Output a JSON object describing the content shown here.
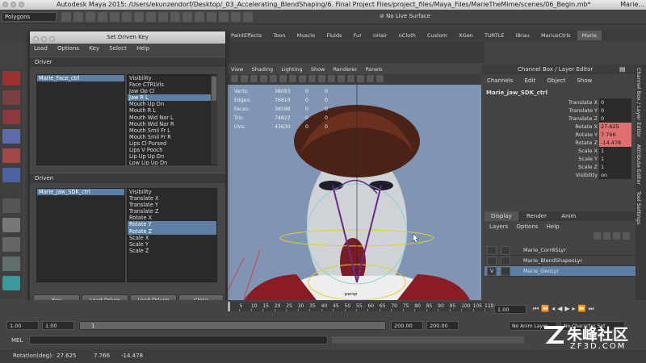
{
  "window": {
    "title": "Autodesk Maya 2015: /Users/ekunzendorf/Desktop/_03_Accelerating_BlendShaping/6. Final Project Files/project_files/Maya_Files/MarieTheMime/scenes/06_Begin.mb*",
    "right_label": "Marie..."
  },
  "statusline": {
    "mode": "Polygons",
    "live_surface": "No Live Surface"
  },
  "shelf": {
    "left_label": "PaintEffects",
    "tabs": [
      "Toon",
      "Muscle",
      "Fluids",
      "Fur",
      "nHair",
      "nCloth",
      "Custom",
      "XGen",
      "TURTLE",
      "iBrau",
      "MariusCtrls",
      "Marie"
    ]
  },
  "dialog": {
    "title": "Set Driven Key",
    "menu": [
      "Load",
      "Options",
      "Key",
      "Select",
      "Help"
    ],
    "driver_header": "Driver",
    "driver_object": "Marie_Face_ctrl",
    "driver_attrs": [
      "Visibility",
      "Face CTRLVis",
      "Jaw Op Cl",
      "Jaw R L",
      "Mouth Up Dn",
      "Mouth R L",
      "Mouth Wid Nar L",
      "Mouth Wid Nar R",
      "Mouth Smil Fr L",
      "Mouth Smil Fr R",
      "Lips Cl Pursed",
      "Lips V Pooch",
      "Lip Up Up Dn",
      "Low Lip Up Dn"
    ],
    "driver_selected_index": 3,
    "driven_header": "Driven",
    "driven_object": "Marie_jaw_SDK_ctrl",
    "driven_attrs": [
      "Visibility",
      "Translate X",
      "Translate Y",
      "Translate Z",
      "Rotate X",
      "Rotate Y",
      "Rotate Z",
      "Scale X",
      "Scale Y",
      "Scale Z"
    ],
    "driven_selected": [
      5,
      6
    ],
    "buttons": [
      "Key",
      "Load Driver",
      "Load Driven",
      "Close"
    ]
  },
  "viewport": {
    "menu": [
      "View",
      "Shading",
      "Lighting",
      "Show",
      "Renderer",
      "Panels"
    ],
    "hud": [
      {
        "label": "Verts:",
        "a": "38093",
        "b": "0",
        "c": "0"
      },
      {
        "label": "Edges:",
        "a": "76819",
        "b": "0",
        "c": "0"
      },
      {
        "label": "Faces:",
        "a": "38598",
        "b": "0",
        "c": "0"
      },
      {
        "label": "Tris:",
        "a": "74822",
        "b": "0",
        "c": "0"
      },
      {
        "label": "UVs:",
        "a": "43630",
        "b": "0",
        "c": "0"
      }
    ],
    "camera_label": "persp"
  },
  "channelbox": {
    "header": "Channel Box / Layer Editor",
    "menu": [
      "Channels",
      "Edit",
      "Object",
      "Show"
    ],
    "object": "Marie_jaw_SDK_ctrl",
    "channels": [
      {
        "name": "Translate X",
        "value": "0",
        "hl": false
      },
      {
        "name": "Translate Y",
        "value": "0",
        "hl": false
      },
      {
        "name": "Translate Z",
        "value": "0",
        "hl": false
      },
      {
        "name": "Rotate X",
        "value": "27.625",
        "hl": true
      },
      {
        "name": "Rotate Y",
        "value": "7.766",
        "hl": true
      },
      {
        "name": "Rotate Z",
        "value": "-14.478",
        "hl": true
      },
      {
        "name": "Scale X",
        "value": "1",
        "hl": false
      },
      {
        "name": "Scale Y",
        "value": "1",
        "hl": false
      },
      {
        "name": "Scale Z",
        "value": "1",
        "hl": false
      },
      {
        "name": "Visibility",
        "value": "on",
        "hl": false
      }
    ]
  },
  "layers": {
    "tabs": [
      "Display",
      "Render",
      "Anim"
    ],
    "menu": [
      "Layers",
      "Options",
      "Help"
    ],
    "items": [
      {
        "name": "Marie_Corr8SLyr",
        "v": "",
        "selected": false
      },
      {
        "name": "Marie_BlendShapesLyr",
        "v": "",
        "selected": false
      },
      {
        "name": "Marie_GeoLyr",
        "v": "V",
        "selected": true
      }
    ]
  },
  "sidetabs": [
    "Channel Box / Layer Editor",
    "Attribute Editor",
    "Tool Settings"
  ],
  "timeline": {
    "ticks": [
      "1",
      "5",
      "10",
      "15",
      "20",
      "25",
      "30",
      "35",
      "40",
      "45",
      "50",
      "55",
      "60",
      "65",
      "70",
      "75",
      "80",
      "85",
      "90",
      "95",
      "100",
      "105",
      "110"
    ],
    "current_frame": "1.00"
  },
  "range": {
    "start": "1.00",
    "inner_start": "1.00",
    "range_value": "1",
    "inner_end": "200.00",
    "end": "200.00",
    "anim_layer": "No Anim Layer",
    "char_set": "No Character Set"
  },
  "mel": {
    "label": "MEL"
  },
  "status": {
    "label": "Rotation(deg):",
    "x": "27.625",
    "y": "7.766",
    "z": "-14.478"
  },
  "watermark": {
    "main": "朱峰社区",
    "sub": "ZF3D.COM"
  }
}
